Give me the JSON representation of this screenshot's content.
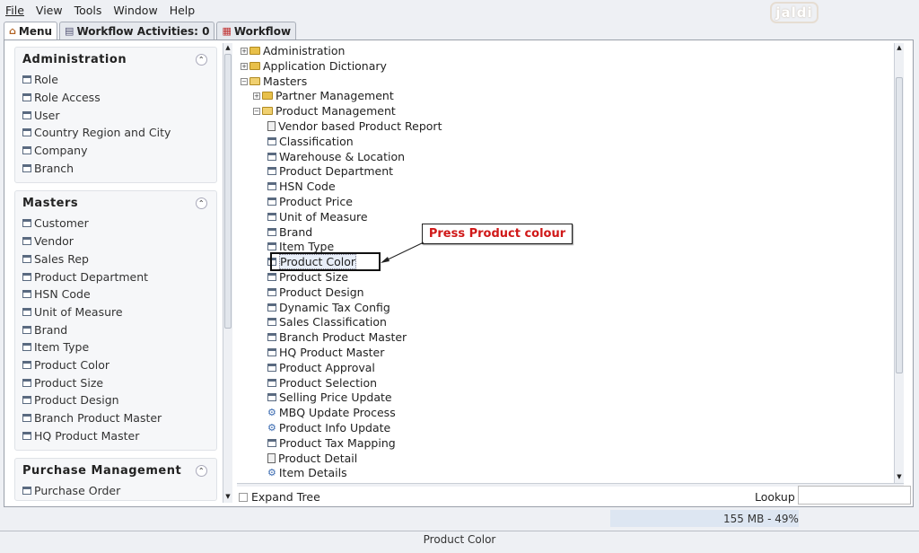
{
  "menubar": {
    "file": "File",
    "view": "View",
    "tools": "Tools",
    "window": "Window",
    "help": "Help"
  },
  "logo_text": "jaldi",
  "tabs": [
    {
      "label": "Menu",
      "icon": "home-icon"
    },
    {
      "label": "Workflow Activities: 0",
      "icon": "list-icon"
    },
    {
      "label": "Workflow",
      "icon": "workflow-icon"
    }
  ],
  "left_sections": [
    {
      "title": "Administration",
      "items": [
        "Role",
        "Role Access",
        "User",
        "Country Region and City",
        "Company",
        "Branch"
      ]
    },
    {
      "title": "Masters",
      "items": [
        "Customer",
        "Vendor",
        "Sales Rep",
        "Product Department",
        "HSN Code",
        "Unit of Measure",
        "Brand",
        "Item Type",
        "Product Color",
        "Product Size",
        "Product Design",
        "Branch Product Master",
        "HQ Product Master"
      ]
    },
    {
      "title": "Purchase Management",
      "items": [
        "Purchase Order"
      ]
    }
  ],
  "tree": {
    "administration": "Administration",
    "application_dictionary": "Application Dictionary",
    "masters": "Masters",
    "partner_management": "Partner Management",
    "product_management": "Product Management",
    "children": [
      {
        "label": "Vendor based Product Report",
        "type": "report"
      },
      {
        "label": "Classification",
        "type": "window"
      },
      {
        "label": "Warehouse & Location",
        "type": "window"
      },
      {
        "label": "Product Department",
        "type": "window"
      },
      {
        "label": "HSN Code",
        "type": "window"
      },
      {
        "label": "Product Price",
        "type": "window"
      },
      {
        "label": "Unit of Measure",
        "type": "window"
      },
      {
        "label": "Brand",
        "type": "window"
      },
      {
        "label": "Item Type",
        "type": "window"
      },
      {
        "label": "Product Color",
        "type": "window"
      },
      {
        "label": "Product Size",
        "type": "window"
      },
      {
        "label": "Product Design",
        "type": "window"
      },
      {
        "label": "Dynamic Tax Config",
        "type": "window"
      },
      {
        "label": "Sales Classification",
        "type": "window"
      },
      {
        "label": "Branch Product Master",
        "type": "window"
      },
      {
        "label": "HQ Product Master",
        "type": "window"
      },
      {
        "label": "Product Approval",
        "type": "window"
      },
      {
        "label": "Product Selection",
        "type": "window"
      },
      {
        "label": "Selling Price Update",
        "type": "window"
      },
      {
        "label": "MBQ Update Process",
        "type": "process"
      },
      {
        "label": "Product Info Update",
        "type": "process"
      },
      {
        "label": "Product Tax Mapping",
        "type": "window"
      },
      {
        "label": "Product Detail",
        "type": "report"
      },
      {
        "label": "Item Details",
        "type": "process"
      }
    ]
  },
  "callout_text": "Press Product colour",
  "expand_tree_label": "Expand Tree",
  "lookup_label": "Lookup",
  "memory": "155 MB - 49%",
  "status": "Product Color"
}
